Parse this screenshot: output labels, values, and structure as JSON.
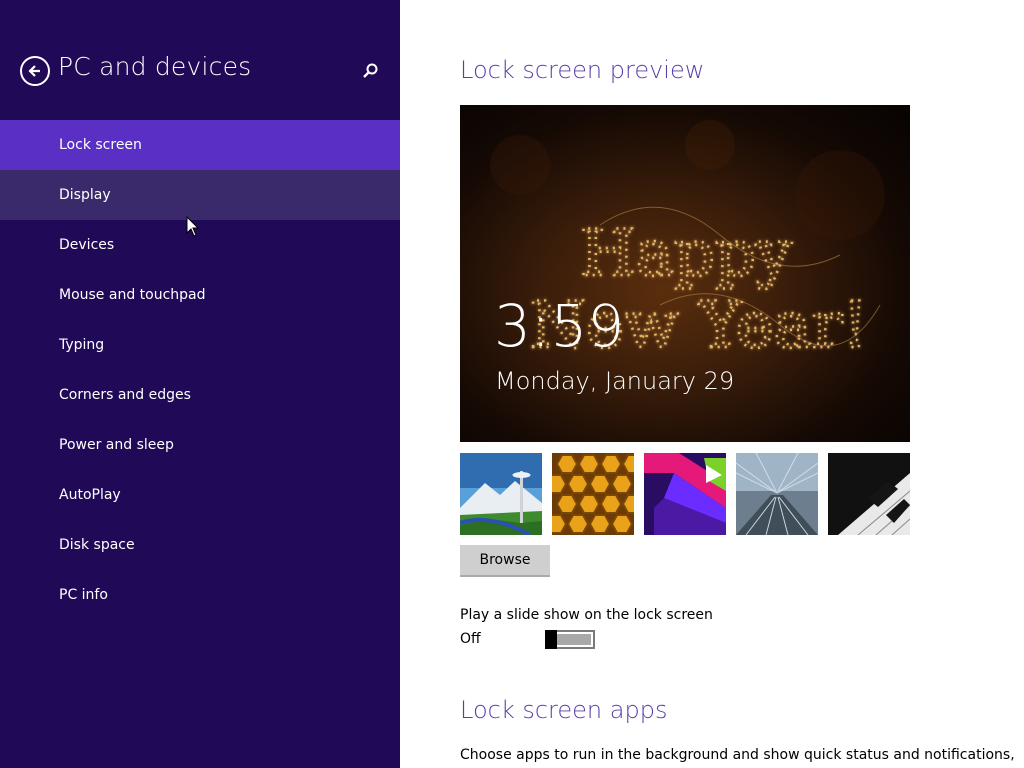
{
  "sidebar": {
    "title": "PC and devices",
    "items": [
      {
        "label": "Lock screen",
        "state": "selected"
      },
      {
        "label": "Display",
        "state": "hover"
      },
      {
        "label": "Devices"
      },
      {
        "label": "Mouse and touchpad"
      },
      {
        "label": "Typing"
      },
      {
        "label": "Corners and edges"
      },
      {
        "label": "Power and sleep"
      },
      {
        "label": "AutoPlay"
      },
      {
        "label": "Disk space"
      },
      {
        "label": "PC info"
      }
    ]
  },
  "main": {
    "preview_title": "Lock screen preview",
    "preview": {
      "time": "3:59",
      "date": "Monday, January 29",
      "art_text_line1": "Happy",
      "art_text_line2": "New Year!"
    },
    "thumbnails": [
      "space-needle",
      "honeycomb",
      "purple-geometric",
      "tunnel",
      "piano-keys"
    ],
    "browse_label": "Browse",
    "slideshow_label": "Play a slide show on the lock screen",
    "slideshow_state": "Off",
    "apps_title": "Lock screen apps",
    "apps_description": "Choose apps to run in the background and show quick status and notifications,"
  },
  "colors": {
    "sidebar_bg": "#200a57",
    "selected_bg": "#5a2fc4",
    "hover_bg": "#3b2a6b",
    "accent_text": "#5a3ea8"
  }
}
